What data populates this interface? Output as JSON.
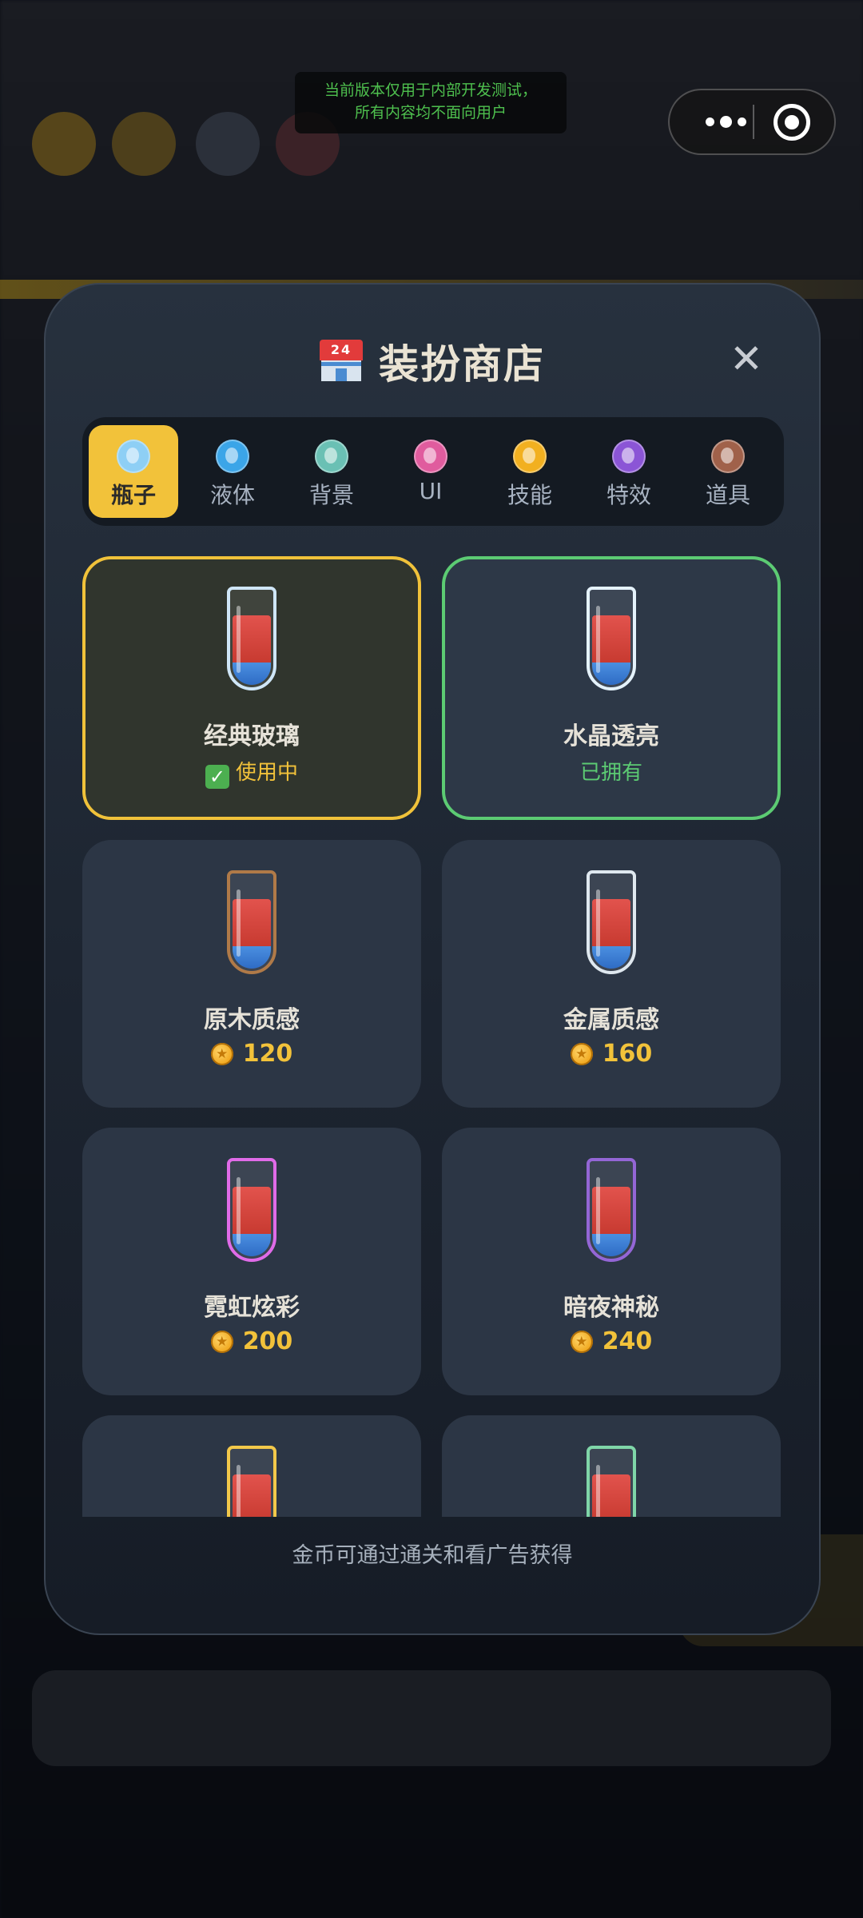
{
  "dev_notice": {
    "line1": "当前版本仅用于内部开发测试，",
    "line2": "所有内容均不面向用户"
  },
  "capsule": {
    "more_icon": "more-dots-icon",
    "close_icon": "target-icon"
  },
  "shop": {
    "title": "装扮商店",
    "title_icon": "convenience-store-icon",
    "title_icon_text": "24",
    "close_label": "✕",
    "footer": "金币可通过通关和看广告获得"
  },
  "tabs": [
    {
      "label": "瓶子",
      "icon": "bottle-icon",
      "color": "#8ecff5",
      "active": true
    },
    {
      "label": "液体",
      "icon": "droplet-icon",
      "color": "#3ba5e8",
      "active": false
    },
    {
      "label": "背景",
      "icon": "landscape-icon",
      "color": "#6ac0b4",
      "active": false
    },
    {
      "label": "UI",
      "icon": "palette-icon",
      "color": "#e05c9e",
      "active": false
    },
    {
      "label": "技能",
      "icon": "lightning-icon",
      "color": "#f2b020",
      "active": false
    },
    {
      "label": "特效",
      "icon": "magic-wand-icon",
      "color": "#8b55d6",
      "active": false
    },
    {
      "label": "道具",
      "icon": "toolbox-icon",
      "color": "#a0614a",
      "active": false
    }
  ],
  "items": [
    {
      "name": "经典玻璃",
      "state": "in_use",
      "status": "使用中",
      "status_color": "#f2c23a",
      "tube_color": "#cfe6f7"
    },
    {
      "name": "水晶透亮",
      "state": "owned",
      "status": "已拥有",
      "status_color": "#5ccb73",
      "tube_color": "#e4f2fb"
    },
    {
      "name": "原木质感",
      "state": "price",
      "price": "120",
      "tube_color": "#b07a48"
    },
    {
      "name": "金属质感",
      "state": "price",
      "price": "160",
      "tube_color": "#dfe8ef"
    },
    {
      "name": "霓虹炫彩",
      "state": "price",
      "price": "200",
      "tube_color": "#e06be8"
    },
    {
      "name": "暗夜神秘",
      "state": "price",
      "price": "240",
      "tube_color": "#9466d6"
    },
    {
      "name": "",
      "state": "partial",
      "tube_color": "#f2c84a"
    },
    {
      "name": "",
      "state": "partial",
      "tube_color": "#7fd6a8"
    }
  ]
}
